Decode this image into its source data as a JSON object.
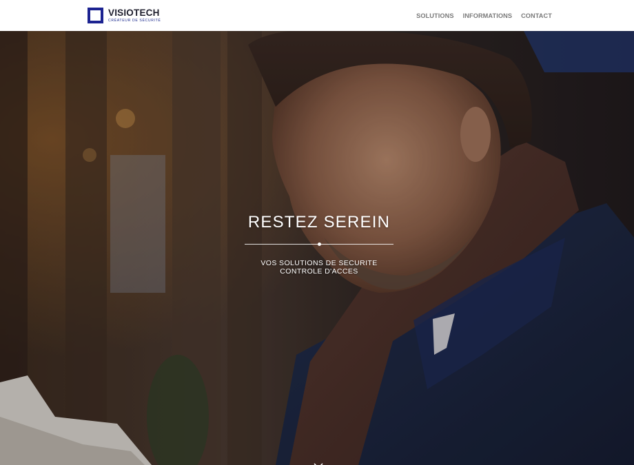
{
  "header": {
    "logo": {
      "name": "VISIOTECH",
      "tagline": "CRÉATEUR DE SÉCURITÉ",
      "mark_icon": "square-bracket-logo-icon",
      "mark_color": "#1c2391"
    },
    "nav": [
      {
        "label": "SOLUTIONS"
      },
      {
        "label": "INFORMATIONS"
      },
      {
        "label": "CONTACT"
      }
    ]
  },
  "hero": {
    "title": "RESTEZ SEREIN",
    "subtitle_line1": "VOS SOLUTIONS DE SECURITE",
    "subtitle_line2": "CONTROLE D'ACCES",
    "background_image": "man-in-scarf-reading-newspaper",
    "scroll_icon": "chevron-down-icon"
  },
  "colors": {
    "nav_text": "#7a7a7a",
    "brand_navy": "#1c2391",
    "hero_text": "#ffffff"
  }
}
